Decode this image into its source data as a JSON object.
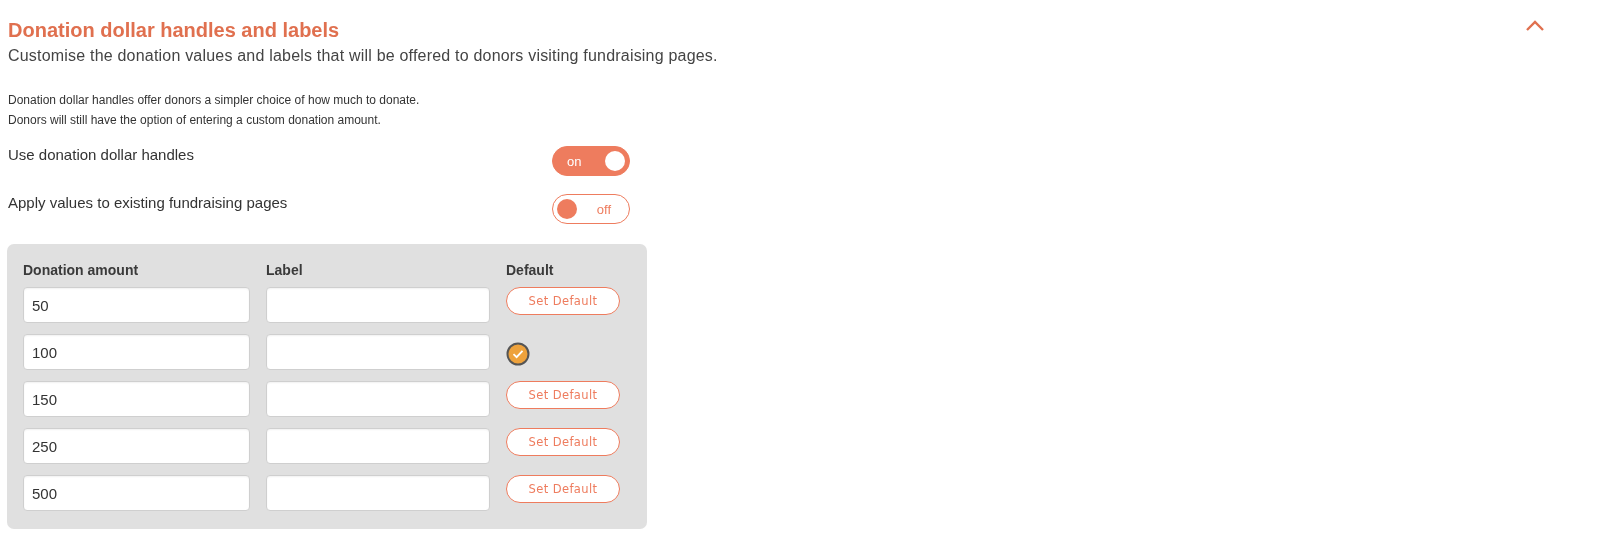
{
  "section": {
    "title": "Donation dollar handles and labels",
    "expanded": true,
    "subtitle": "Customise the donation values and labels that will be offered to donors visiting fundraising pages."
  },
  "description": [
    "Donation dollar handles offer donors a simpler choice of how much to donate.",
    "Donors will still have the option of entering a custom donation amount."
  ],
  "toggles": [
    {
      "label": "Use donation dollar handles",
      "on": true,
      "state_text": "on"
    },
    {
      "label": "Apply values to existing fundraising pages",
      "on": false,
      "state_text": "off"
    }
  ],
  "table": {
    "columns": [
      "Donation amount",
      "Label",
      "Default"
    ],
    "rows": [
      {
        "amount": "50",
        "selected": false,
        "button": "Set Default"
      },
      {
        "amount": "100",
        "selected": true
      },
      {
        "amount": "150",
        "selected": false,
        "button": "Set Default"
      },
      {
        "amount": "250",
        "selected": false,
        "button": "Set Default"
      },
      {
        "amount": "500",
        "selected": false,
        "button": "Set Default"
      }
    ]
  }
}
